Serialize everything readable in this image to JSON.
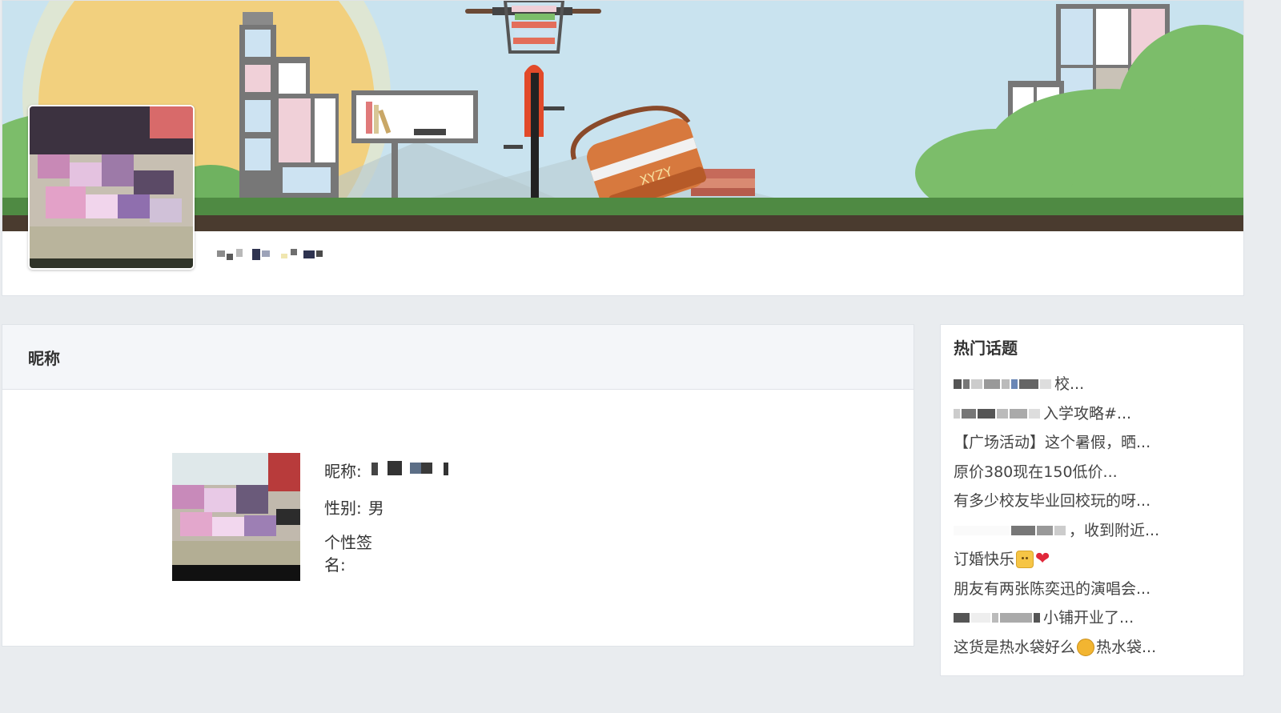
{
  "profile": {
    "cover_alt": "cover banner",
    "avatar_alt": "user avatar"
  },
  "banner": {
    "bag_text": "XYZY"
  },
  "main": {
    "header_title": "昵称",
    "nickname_label": "昵称:",
    "gender_label": "性别:",
    "gender_value": "男",
    "signature_label": "个性签名:"
  },
  "sidebar": {
    "title": "热门话题",
    "topics": [
      "校...",
      "入学攻略#...",
      "【广场活动】这个暑假，晒...",
      "原价380现在150低价...",
      "有多少校友毕业回校玩的呀...",
      "，收到附近...",
      "订婚快乐",
      "朋友有两张陈奕迅的演唱会...",
      "小铺开业了...",
      "这货是热水袋好么",
      "热水袋..."
    ]
  },
  "colors": {
    "sky": "#c9e3ef",
    "sun": "#f2d07e",
    "grass": "#7cbd6a",
    "ground": "#4a3b2f",
    "bag": "#d7793e"
  }
}
